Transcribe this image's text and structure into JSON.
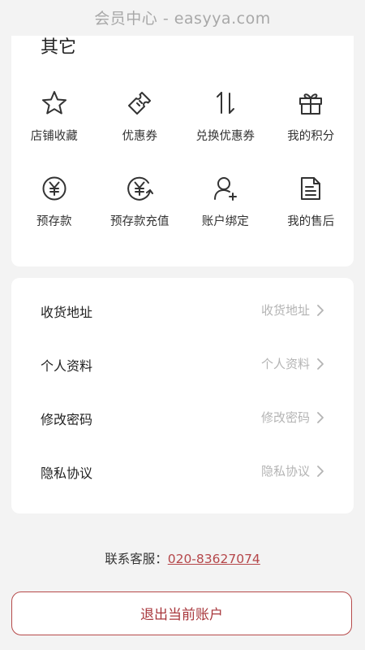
{
  "header": {
    "watermark": "会员中心 - easyya.com"
  },
  "other_section": {
    "title": "其它",
    "items": [
      {
        "label": "店铺收藏",
        "icon": "star-icon"
      },
      {
        "label": "优惠券",
        "icon": "ticket-icon"
      },
      {
        "label": "兑换优惠券",
        "icon": "exchange-arrows-icon"
      },
      {
        "label": "我的积分",
        "icon": "gift-icon"
      },
      {
        "label": "预存款",
        "icon": "yen-circle-icon"
      },
      {
        "label": "预存款充值",
        "icon": "yen-recharge-icon"
      },
      {
        "label": "账户绑定",
        "icon": "user-add-icon"
      },
      {
        "label": "我的售后",
        "icon": "document-icon"
      }
    ]
  },
  "settings": {
    "rows": [
      {
        "label": "收货地址",
        "value": "收货地址"
      },
      {
        "label": "个人资料",
        "value": "个人资料"
      },
      {
        "label": "修改密码",
        "value": "修改密码"
      },
      {
        "label": "隐私协议",
        "value": "隐私协议"
      }
    ]
  },
  "contact": {
    "label": "联系客服：",
    "phone": "020-83627074"
  },
  "logout": {
    "label": "退出当前账户"
  },
  "colors": {
    "accent": "#b64a4a",
    "background": "#f3f3f3",
    "muted": "#b4b4b4"
  }
}
